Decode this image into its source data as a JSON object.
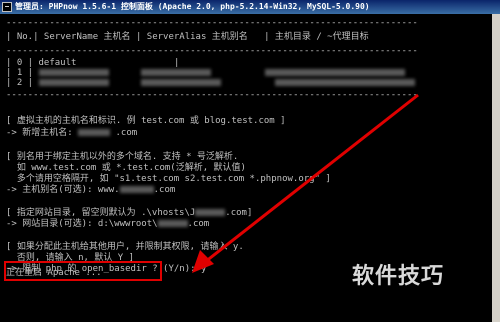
{
  "window": {
    "title": "管理员:  PHPnow 1.5.6-1 控制面板 (Apache 2.0, php-5.2.14-Win32, MySQL-5.0.90)"
  },
  "table": {
    "divider": "----------------------------------------------------------------------------",
    "header": "| No.| ServerName 主机名 | ServerAlias 主机别名   | 主机目录 / ~代理目标",
    "rows": [
      {
        "text": "| 0 | default",
        "blur_width": 0
      },
      {
        "text": "| 1 |",
        "blur_width": 1
      },
      {
        "text": "| 2 |",
        "blur_width": 1
      }
    ]
  },
  "prompts": [
    "[ 虚拟主机的主机名和标识. 例 test.com 或 blog.test.com ]",
    "-> 新增主机名: ",
    "[ 别名用于绑定主机以外的多个域名. 支持 * 号泛解析.",
    "  如 www.test.com 或 *.test.com(泛解析, 默认值)",
    "  多个请用空格隔开, 如 \"s1.test.com s2.test.com *.phpnow.org\" ]",
    "-> 主机别名(可选): www.",
    "[ 指定网站目录, 留空则默认为 .\\vhosts\\J",
    "-> 网站目录(可选): d:\\wwwroot\\",
    "[ 如果分配此主机给其他用户, 并限制其权限, 请输入 y.",
    "  否则, 请输入 n, 默认 Y ]",
    "-> 限制 php 的 open_basedir ? (Y/n): y"
  ],
  "suffixes": {
    "new_host": ".com",
    "alias": ".com",
    "dir_hint": ".com]",
    "dir": ".com"
  },
  "status": "正在重启 Apache ...",
  "watermark": "软件技巧",
  "colors": {
    "console_bg": "#000000",
    "console_text": "#c0c0c0",
    "highlight": "#e00000",
    "arrow": "#e00000"
  }
}
